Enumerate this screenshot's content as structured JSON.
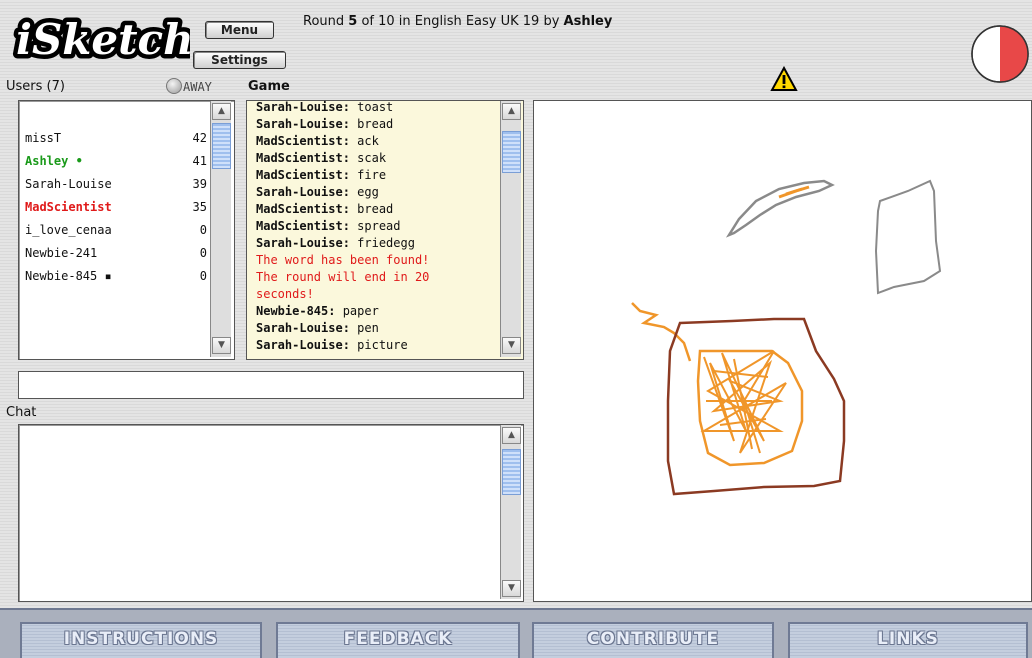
{
  "header": {
    "logo_text": "iSketch",
    "menu_label": "Menu",
    "settings_label": "Settings",
    "round_prefix": "Round ",
    "round_number": "5",
    "round_middle": " of 10 in English Easy UK 19 by ",
    "round_artist": "Ashley"
  },
  "users": {
    "heading": "Users (7)",
    "away_label": "AWAY",
    "list": [
      {
        "name": "missT",
        "score": "42",
        "color": "#111111",
        "bold": false
      },
      {
        "name": "Ashley •",
        "score": "41",
        "color": "#1a9a1a",
        "bold": true
      },
      {
        "name": "Sarah-Louise",
        "score": "39",
        "color": "#111111",
        "bold": false
      },
      {
        "name": "MadScientist",
        "score": "35",
        "color": "#e01a1a",
        "bold": true
      },
      {
        "name": "i_love_cenaa",
        "score": "0",
        "color": "#111111",
        "bold": false
      },
      {
        "name": "Newbie-241",
        "score": "0",
        "color": "#111111",
        "bold": false
      },
      {
        "name": "Newbie-845 ▪",
        "score": "0",
        "color": "#111111",
        "bold": false
      }
    ]
  },
  "game": {
    "heading": "Game",
    "messages": [
      {
        "user": "Sarah-Louise:",
        "text": " toast"
      },
      {
        "user": "Sarah-Louise:",
        "text": " bread"
      },
      {
        "user": "MadScientist:",
        "text": " ack"
      },
      {
        "user": "MadScientist:",
        "text": " scak"
      },
      {
        "user": "MadScientist:",
        "text": " fire"
      },
      {
        "user": "Sarah-Louise:",
        "text": " egg"
      },
      {
        "user": "MadScientist:",
        "text": " bread"
      },
      {
        "user": "MadScientist:",
        "text": " spread"
      },
      {
        "user": "Sarah-Louise:",
        "text": " friedegg"
      },
      {
        "system": "The word has been found!"
      },
      {
        "system": "The round will end in 20"
      },
      {
        "system": "seconds!"
      },
      {
        "user": "Newbie-845:",
        "text": " paper"
      },
      {
        "user": "Sarah-Louise:",
        "text": " pen"
      },
      {
        "user": "Sarah-Louise:",
        "text": " picture"
      }
    ]
  },
  "chat": {
    "heading": "Chat",
    "input_value": ""
  },
  "nav": {
    "instructions": "INSTRUCTIONS",
    "feedback": "FEEDBACK",
    "contribute": "CONTRIBUTE",
    "links": "LINKS"
  },
  "icons": {
    "warning": "warning-icon",
    "timer": "timer-icon"
  },
  "colors": {
    "system_message": "#e01a1a",
    "current_artist": "#1a9a1a",
    "game_log_bg": "#fbf8dc",
    "timer_fill": "#e84848",
    "stroke_orange": "#f0962a",
    "stroke_brown": "#8b3a22",
    "stroke_gray": "#8a8a8a"
  },
  "timer": {
    "fraction_remaining": 0.5
  }
}
